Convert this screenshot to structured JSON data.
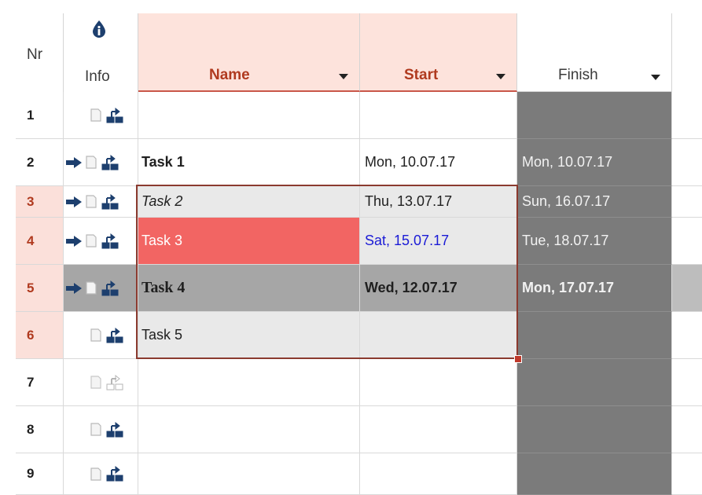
{
  "columns": {
    "nr": "Nr",
    "info": "Info",
    "name": "Name",
    "start": "Start",
    "finish": "Finish"
  },
  "colors": {
    "header_highlight": "#fde3dc",
    "row_selected_nr": "#fbe0da",
    "selection_border": "#8b3a2f",
    "finish_column": "#7b7b7b",
    "task3_fill": "#f26563",
    "task4_row": "#a6a6a6",
    "icon_blue": "#1d3f6e",
    "date_blue": "#1b1bd6"
  },
  "rows": [
    {
      "nr": "1",
      "name": "",
      "start": "",
      "finish": "",
      "arrow": false,
      "icons_dim": false
    },
    {
      "nr": "2",
      "name": "Task 1",
      "start": "Mon, 10.07.17",
      "finish": "Mon, 10.07.17",
      "arrow": true,
      "icons_dim": false
    },
    {
      "nr": "3",
      "name": "Task 2",
      "start": "Thu, 13.07.17",
      "finish": "Sun, 16.07.17",
      "arrow": true,
      "icons_dim": false
    },
    {
      "nr": "4",
      "name": "Task 3",
      "start": "Sat, 15.07.17",
      "finish": "Tue, 18.07.17",
      "arrow": true,
      "icons_dim": false
    },
    {
      "nr": "5",
      "name": "Task 4",
      "start": "Wed, 12.07.17",
      "finish": "Mon, 17.07.17",
      "arrow": true,
      "icons_dim": false
    },
    {
      "nr": "6",
      "name": "Task 5",
      "start": "",
      "finish": "",
      "arrow": false,
      "icons_dim": false
    },
    {
      "nr": "7",
      "name": "",
      "start": "",
      "finish": "",
      "arrow": false,
      "icons_dim": true
    },
    {
      "nr": "8",
      "name": "",
      "start": "",
      "finish": "",
      "arrow": false,
      "icons_dim": false
    },
    {
      "nr": "9",
      "name": "",
      "start": "",
      "finish": "",
      "arrow": false,
      "icons_dim": false
    }
  ]
}
